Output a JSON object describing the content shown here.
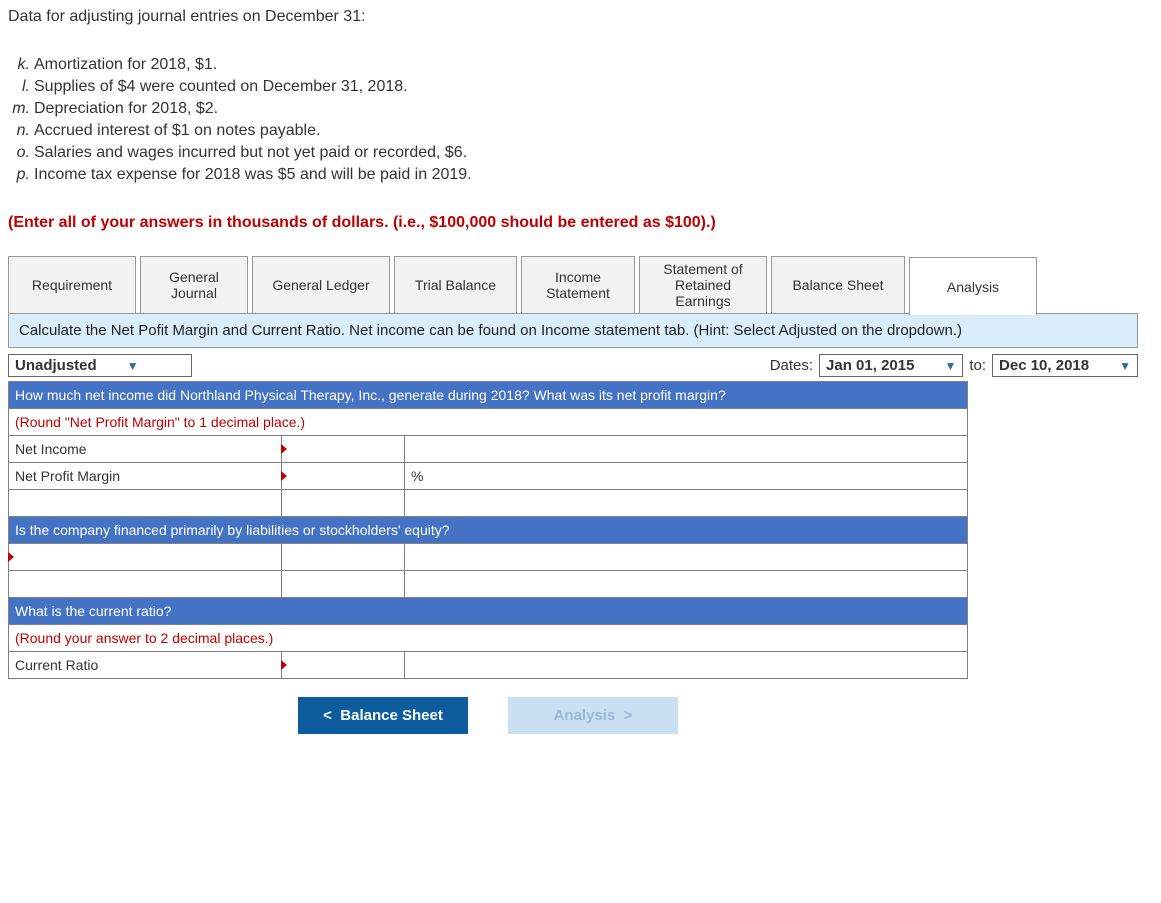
{
  "intro": {
    "title": "Data for adjusting journal entries on December 31:",
    "items": [
      {
        "letter": "k.",
        "text": "Amortization for 2018, $1."
      },
      {
        "letter": "l.",
        "text": "Supplies of $4 were counted on December 31, 2018."
      },
      {
        "letter": "m.",
        "text": "Depreciation for 2018, $2."
      },
      {
        "letter": "n.",
        "text": "Accrued interest of $1 on notes payable."
      },
      {
        "letter": "o.",
        "text": "Salaries and wages incurred but not yet paid or recorded, $6."
      },
      {
        "letter": "p.",
        "text": "Income tax expense for 2018 was $5 and will be paid in 2019."
      }
    ],
    "enter_note": "(Enter all of your answers in thousands of dollars. (i.e., $100,000 should be entered as $100).)"
  },
  "tabs": [
    "Requirement",
    "General Journal",
    "General Ledger",
    "Trial Balance",
    "Income Statement",
    "Statement of Retained Earnings",
    "Balance Sheet",
    "Analysis"
  ],
  "instruction": "Calculate the Net Pofit Margin and Current Ratio. Net income can be found on Income statement tab. (Hint: Select Adjusted on the dropdown.)",
  "dropdown": {
    "value": "Unadjusted",
    "dates_label": "Dates:",
    "from": "Jan 01, 2015",
    "to_label": "to:",
    "to": "Dec 10, 2018"
  },
  "section1": {
    "q": "How much net income did Northland Physical Therapy, Inc., generate during 2018? What was its net profit margin?",
    "instr": "(Round \"Net Profit Margin\" to 1 decimal place.)",
    "row1_label": "Net Income",
    "row2_label": "Net Profit Margin",
    "percent": "%"
  },
  "section2": {
    "q": "Is the company financed primarily by liabilities or stockholders' equity?"
  },
  "section3": {
    "q": "What is the current ratio?",
    "instr": "(Round your answer to 2 decimal places.)",
    "row_label": "Current Ratio"
  },
  "nav": {
    "prev": "Balance Sheet",
    "next": "Analysis"
  }
}
